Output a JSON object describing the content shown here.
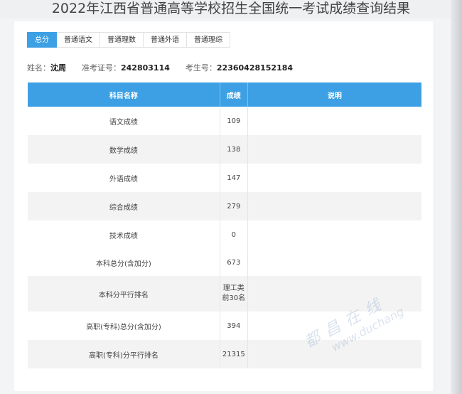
{
  "page": {
    "title": "2022年江西省普通高等学校招生全国统一考试成绩查询结果"
  },
  "tabs": [
    {
      "label": "总分",
      "active": true
    },
    {
      "label": "普通语文",
      "active": false
    },
    {
      "label": "普通理数",
      "active": false
    },
    {
      "label": "普通外语",
      "active": false
    },
    {
      "label": "普通理综",
      "active": false
    }
  ],
  "info": {
    "name_label": "姓名：",
    "name_value": "沈周",
    "ticket_label": "准考证号：",
    "ticket_value": "242803114",
    "examinee_label": "考生号：",
    "examinee_value": "22360428152184"
  },
  "table": {
    "headers": [
      "科目名称",
      "成绩",
      "说明"
    ],
    "rows": [
      {
        "subject": "语文成绩",
        "score": "109",
        "note": ""
      },
      {
        "subject": "数学成绩",
        "score": "138",
        "note": ""
      },
      {
        "subject": "外语成绩",
        "score": "147",
        "note": ""
      },
      {
        "subject": "综合成绩",
        "score": "279",
        "note": ""
      },
      {
        "subject": "技术成绩",
        "score": "0",
        "note": ""
      },
      {
        "subject": "本科总分(含加分)",
        "score": "673",
        "note": ""
      },
      {
        "subject": "本科分平行排名",
        "score": "理工类前30名",
        "note": ""
      },
      {
        "subject": "高职(专科)总分(含加分)",
        "score": "394",
        "note": ""
      },
      {
        "subject": "高职(专科)分平行排名",
        "score": "21315",
        "note": ""
      }
    ]
  },
  "watermark": {
    "line1": "都昌在线",
    "line2": "www.duchang"
  }
}
